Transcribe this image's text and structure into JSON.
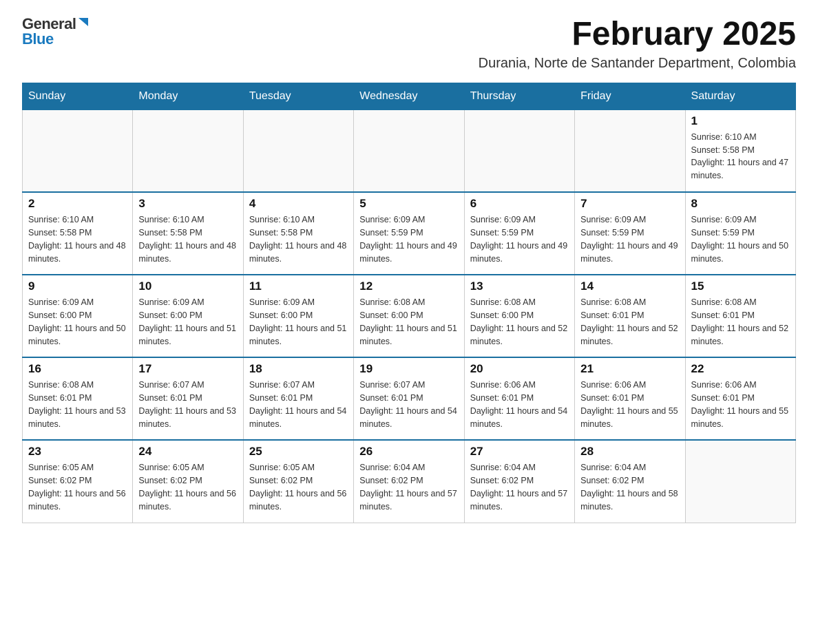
{
  "logo": {
    "general": "General",
    "blue": "Blue"
  },
  "header": {
    "title": "February 2025",
    "subtitle": "Durania, Norte de Santander Department, Colombia"
  },
  "weekdays": [
    "Sunday",
    "Monday",
    "Tuesday",
    "Wednesday",
    "Thursday",
    "Friday",
    "Saturday"
  ],
  "weeks": [
    [
      {
        "day": "",
        "info": ""
      },
      {
        "day": "",
        "info": ""
      },
      {
        "day": "",
        "info": ""
      },
      {
        "day": "",
        "info": ""
      },
      {
        "day": "",
        "info": ""
      },
      {
        "day": "",
        "info": ""
      },
      {
        "day": "1",
        "info": "Sunrise: 6:10 AM\nSunset: 5:58 PM\nDaylight: 11 hours and 47 minutes."
      }
    ],
    [
      {
        "day": "2",
        "info": "Sunrise: 6:10 AM\nSunset: 5:58 PM\nDaylight: 11 hours and 48 minutes."
      },
      {
        "day": "3",
        "info": "Sunrise: 6:10 AM\nSunset: 5:58 PM\nDaylight: 11 hours and 48 minutes."
      },
      {
        "day": "4",
        "info": "Sunrise: 6:10 AM\nSunset: 5:58 PM\nDaylight: 11 hours and 48 minutes."
      },
      {
        "day": "5",
        "info": "Sunrise: 6:09 AM\nSunset: 5:59 PM\nDaylight: 11 hours and 49 minutes."
      },
      {
        "day": "6",
        "info": "Sunrise: 6:09 AM\nSunset: 5:59 PM\nDaylight: 11 hours and 49 minutes."
      },
      {
        "day": "7",
        "info": "Sunrise: 6:09 AM\nSunset: 5:59 PM\nDaylight: 11 hours and 49 minutes."
      },
      {
        "day": "8",
        "info": "Sunrise: 6:09 AM\nSunset: 5:59 PM\nDaylight: 11 hours and 50 minutes."
      }
    ],
    [
      {
        "day": "9",
        "info": "Sunrise: 6:09 AM\nSunset: 6:00 PM\nDaylight: 11 hours and 50 minutes."
      },
      {
        "day": "10",
        "info": "Sunrise: 6:09 AM\nSunset: 6:00 PM\nDaylight: 11 hours and 51 minutes."
      },
      {
        "day": "11",
        "info": "Sunrise: 6:09 AM\nSunset: 6:00 PM\nDaylight: 11 hours and 51 minutes."
      },
      {
        "day": "12",
        "info": "Sunrise: 6:08 AM\nSunset: 6:00 PM\nDaylight: 11 hours and 51 minutes."
      },
      {
        "day": "13",
        "info": "Sunrise: 6:08 AM\nSunset: 6:00 PM\nDaylight: 11 hours and 52 minutes."
      },
      {
        "day": "14",
        "info": "Sunrise: 6:08 AM\nSunset: 6:01 PM\nDaylight: 11 hours and 52 minutes."
      },
      {
        "day": "15",
        "info": "Sunrise: 6:08 AM\nSunset: 6:01 PM\nDaylight: 11 hours and 52 minutes."
      }
    ],
    [
      {
        "day": "16",
        "info": "Sunrise: 6:08 AM\nSunset: 6:01 PM\nDaylight: 11 hours and 53 minutes."
      },
      {
        "day": "17",
        "info": "Sunrise: 6:07 AM\nSunset: 6:01 PM\nDaylight: 11 hours and 53 minutes."
      },
      {
        "day": "18",
        "info": "Sunrise: 6:07 AM\nSunset: 6:01 PM\nDaylight: 11 hours and 54 minutes."
      },
      {
        "day": "19",
        "info": "Sunrise: 6:07 AM\nSunset: 6:01 PM\nDaylight: 11 hours and 54 minutes."
      },
      {
        "day": "20",
        "info": "Sunrise: 6:06 AM\nSunset: 6:01 PM\nDaylight: 11 hours and 54 minutes."
      },
      {
        "day": "21",
        "info": "Sunrise: 6:06 AM\nSunset: 6:01 PM\nDaylight: 11 hours and 55 minutes."
      },
      {
        "day": "22",
        "info": "Sunrise: 6:06 AM\nSunset: 6:01 PM\nDaylight: 11 hours and 55 minutes."
      }
    ],
    [
      {
        "day": "23",
        "info": "Sunrise: 6:05 AM\nSunset: 6:02 PM\nDaylight: 11 hours and 56 minutes."
      },
      {
        "day": "24",
        "info": "Sunrise: 6:05 AM\nSunset: 6:02 PM\nDaylight: 11 hours and 56 minutes."
      },
      {
        "day": "25",
        "info": "Sunrise: 6:05 AM\nSunset: 6:02 PM\nDaylight: 11 hours and 56 minutes."
      },
      {
        "day": "26",
        "info": "Sunrise: 6:04 AM\nSunset: 6:02 PM\nDaylight: 11 hours and 57 minutes."
      },
      {
        "day": "27",
        "info": "Sunrise: 6:04 AM\nSunset: 6:02 PM\nDaylight: 11 hours and 57 minutes."
      },
      {
        "day": "28",
        "info": "Sunrise: 6:04 AM\nSunset: 6:02 PM\nDaylight: 11 hours and 58 minutes."
      },
      {
        "day": "",
        "info": ""
      }
    ]
  ]
}
